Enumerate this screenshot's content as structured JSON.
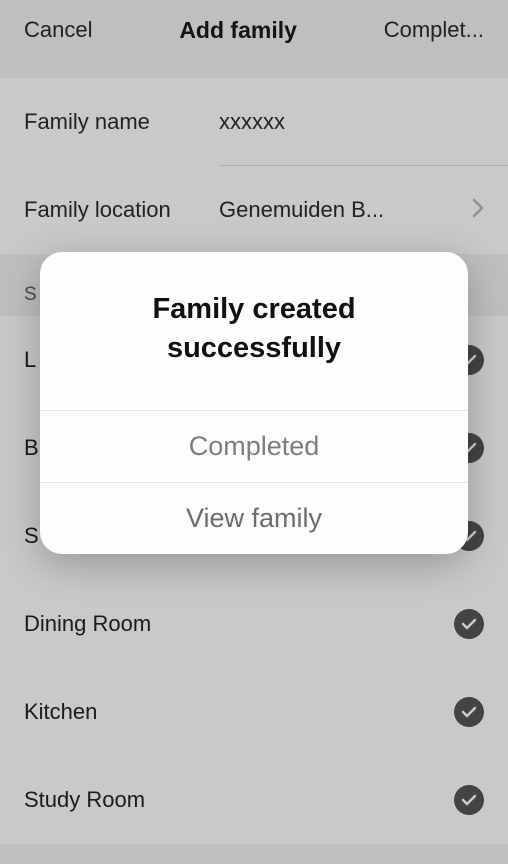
{
  "nav": {
    "cancel": "Cancel",
    "title": "Add family",
    "complete": "Complet..."
  },
  "form": {
    "name_label": "Family name",
    "name_value": "xxxxxx",
    "location_label": "Family location",
    "location_value": "Genemuiden B..."
  },
  "section_header_prefix": "S",
  "rooms": [
    {
      "label": "L"
    },
    {
      "label": "B"
    },
    {
      "label": "S"
    },
    {
      "label": "Dining Room"
    },
    {
      "label": "Kitchen"
    },
    {
      "label": "Study Room"
    }
  ],
  "alert": {
    "title_line1": "Family created",
    "title_line2": "successfully",
    "completed": "Completed",
    "view": "View family"
  }
}
